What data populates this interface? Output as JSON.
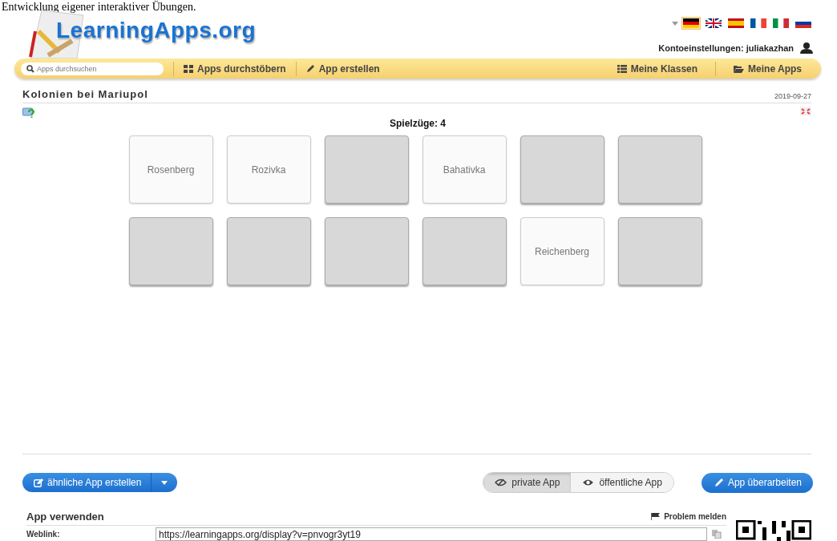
{
  "page_caption": "Entwicklung eigener interaktiver Übungen.",
  "header": {
    "logo": "LearningApps.org",
    "languages": [
      {
        "kind": "de",
        "selected": true
      },
      {
        "kind": "en",
        "selected": false
      },
      {
        "kind": "es",
        "selected": false
      },
      {
        "kind": "fr",
        "selected": false
      },
      {
        "kind": "it",
        "selected": false
      },
      {
        "kind": "ru",
        "selected": false
      }
    ],
    "account": "Kontoeinstellungen: juliakazhan"
  },
  "nav": {
    "search": {
      "placeholder": "Apps durchsuchen"
    },
    "items": [
      {
        "label": "Apps durchstöbern",
        "kind": "grid"
      },
      {
        "label": "App erstellen",
        "kind": "pencil"
      }
    ],
    "right_items": [
      {
        "label": "Meine Klassen",
        "kind": "list"
      },
      {
        "label": "Meine Apps",
        "kind": "folder"
      }
    ]
  },
  "app": {
    "title": "Kolonien bei Mariupol",
    "date": "2019-09-27",
    "moves": "Spielzüge: 4",
    "cards": [
      {
        "label": "Rosenberg",
        "revealed": true
      },
      {
        "label": "Rozivka",
        "revealed": true
      },
      {
        "revealed": false
      },
      {
        "label": "Bahativka",
        "revealed": true
      },
      {
        "revealed": false
      },
      {
        "revealed": false
      },
      {
        "revealed": false
      },
      {
        "revealed": false
      },
      {
        "revealed": false
      },
      {
        "revealed": false
      },
      {
        "label": "Reichenberg",
        "revealed": true
      },
      {
        "revealed": false
      }
    ]
  },
  "actions": {
    "similar": "ähnliche App erstellen",
    "visibility": [
      {
        "label": "private App",
        "kind": "private",
        "selected": true
      },
      {
        "label": "öffentliche App",
        "kind": "public",
        "selected": false
      }
    ],
    "edit": "App überarbeiten"
  },
  "use": {
    "heading": "App verwenden",
    "report": "Problem melden",
    "weblink_label": "Weblink:",
    "weblink": "https://learningapps.org/display?v=pnvogr3yt19"
  }
}
